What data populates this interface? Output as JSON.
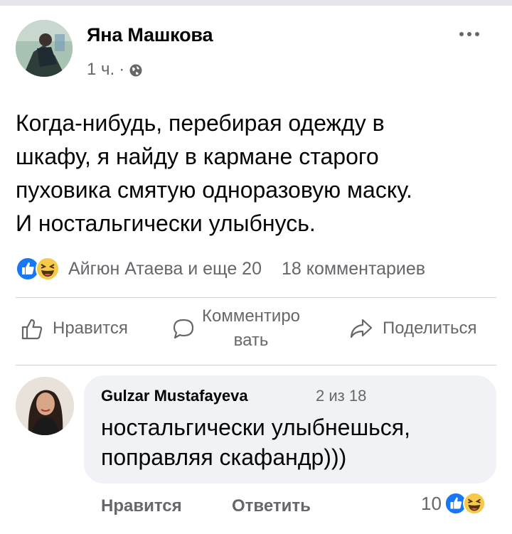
{
  "post": {
    "author": "Яна Машкова",
    "time": "1 ч.",
    "separator": "·",
    "text_lines": [
      "Когда-нибудь, перебирая одежду в",
      "шкафу, я найду в кармане старого",
      "пуховика смятую одноразовую маску.",
      "И ностальгически улыбнусь."
    ],
    "more_icon": "more-dots-icon",
    "privacy_icon": "globe-icon"
  },
  "reactions": {
    "icons": [
      "like-reaction-icon",
      "haha-reaction-icon"
    ],
    "names_text": "Айгюн Атаева и еще 20",
    "comments_text": "18 комментариев"
  },
  "actions": {
    "like_label": "Нравится",
    "comment_label_line1": "Комментиро",
    "comment_label_line2": "вать",
    "share_label": "Поделиться"
  },
  "comment": {
    "author": "Gulzar Mustafayeva",
    "position": "2 из 18",
    "text_lines": [
      "ностальгически улыбнешься,",
      "поправляя скафандр)))"
    ],
    "like_label": "Нравится",
    "reply_label": "Ответить",
    "reaction_count": "10"
  },
  "colors": {
    "like_blue": "#1877f2",
    "haha_yellow": "#f7c94b",
    "secondary_text": "#65676b",
    "bubble_bg": "#f0f2f5"
  }
}
